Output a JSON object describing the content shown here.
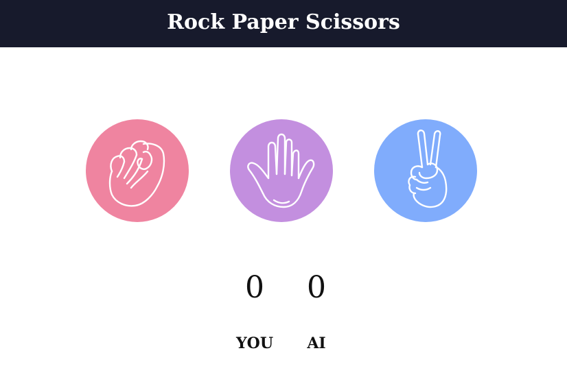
{
  "header": {
    "title": "Rock Paper Scissors",
    "background": "#171a2c"
  },
  "choices": [
    {
      "id": "rock",
      "icon": "fist-icon",
      "color": "#ef84a0"
    },
    {
      "id": "paper",
      "icon": "open-hand-icon",
      "color": "#c38fdf"
    },
    {
      "id": "scissors",
      "icon": "peace-hand-icon",
      "color": "#80acfc"
    }
  ],
  "score": {
    "you": {
      "value": "0",
      "label": "YOU"
    },
    "ai": {
      "value": "0",
      "label": "AI"
    }
  }
}
